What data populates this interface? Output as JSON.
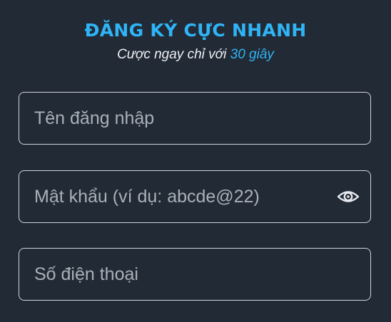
{
  "header": {
    "title": "ĐĂNG KÝ CỰC NHANH",
    "subtitle_prefix": "Cược ngay chỉ với ",
    "subtitle_highlight": "30 giây"
  },
  "form": {
    "username_placeholder": "Tên đăng nhập",
    "password_placeholder": "Mật khẩu (ví dụ: abcde@22)",
    "password_icon": "eye-icon",
    "phone_placeholder": "Số điện thoại"
  },
  "colors": {
    "background": "#222a35",
    "accent": "#2fb4f5",
    "field_border": "#cfd5dc",
    "placeholder": "#a9b0b8"
  }
}
